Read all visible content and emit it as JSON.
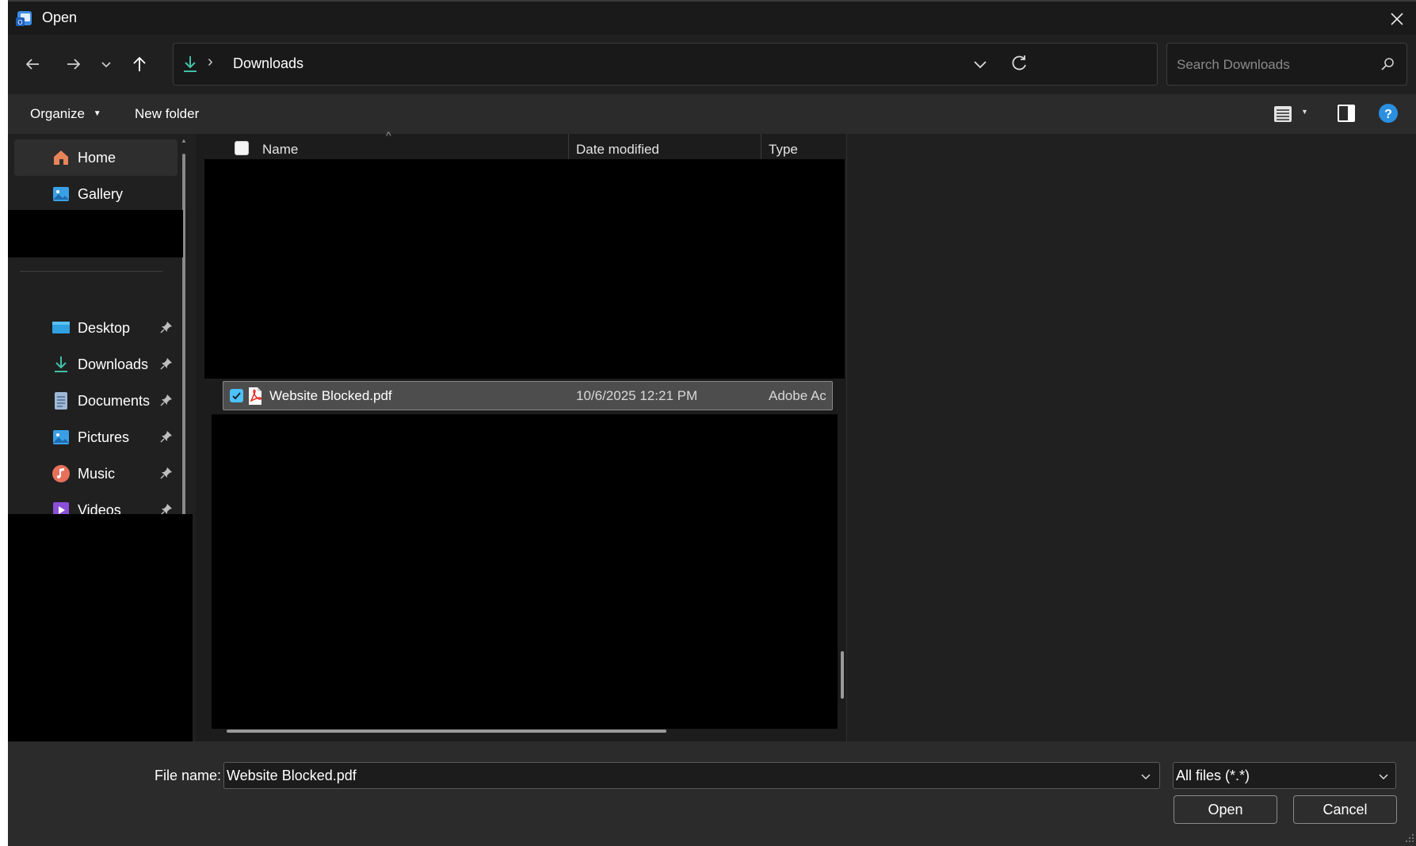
{
  "window": {
    "title": "Open"
  },
  "nav": {
    "back_icon": "arrow-left-icon",
    "forward_icon": "arrow-right-icon",
    "recent_icon": "chevron-down-icon",
    "up_icon": "arrow-up-icon"
  },
  "address": {
    "location": "Downloads",
    "separator": "›"
  },
  "search": {
    "placeholder": "Search Downloads"
  },
  "toolbar": {
    "organize_label": "Organize",
    "new_folder_label": "New folder"
  },
  "sidebar": {
    "top_items": [
      {
        "label": "Home",
        "icon": "home-icon"
      },
      {
        "label": "Gallery",
        "icon": "gallery-icon"
      }
    ],
    "pinned_items": [
      {
        "label": "Desktop",
        "icon": "desktop-icon"
      },
      {
        "label": "Downloads",
        "icon": "download-icon"
      },
      {
        "label": "Documents",
        "icon": "document-icon"
      },
      {
        "label": "Pictures",
        "icon": "pictures-icon"
      },
      {
        "label": "Music",
        "icon": "music-icon"
      },
      {
        "label": "Videos",
        "icon": "videos-icon"
      }
    ]
  },
  "file_list": {
    "columns": {
      "name": "Name",
      "date_modified": "Date modified",
      "type": "Type"
    },
    "rows": [
      {
        "name": "Website Blocked.pdf",
        "date_modified": "10/6/2025 12:21 PM",
        "type": "Adobe Ac",
        "selected": true
      }
    ]
  },
  "bottom": {
    "file_name_label": "File name:",
    "file_name_value": "Website Blocked.pdf",
    "file_type_value": "All files (*.*)",
    "open_label": "Open",
    "cancel_label": "Cancel"
  },
  "colors": {
    "accent": "#4cc2ff",
    "selection": "#4d4d4d",
    "help": "#2b8fe0"
  }
}
